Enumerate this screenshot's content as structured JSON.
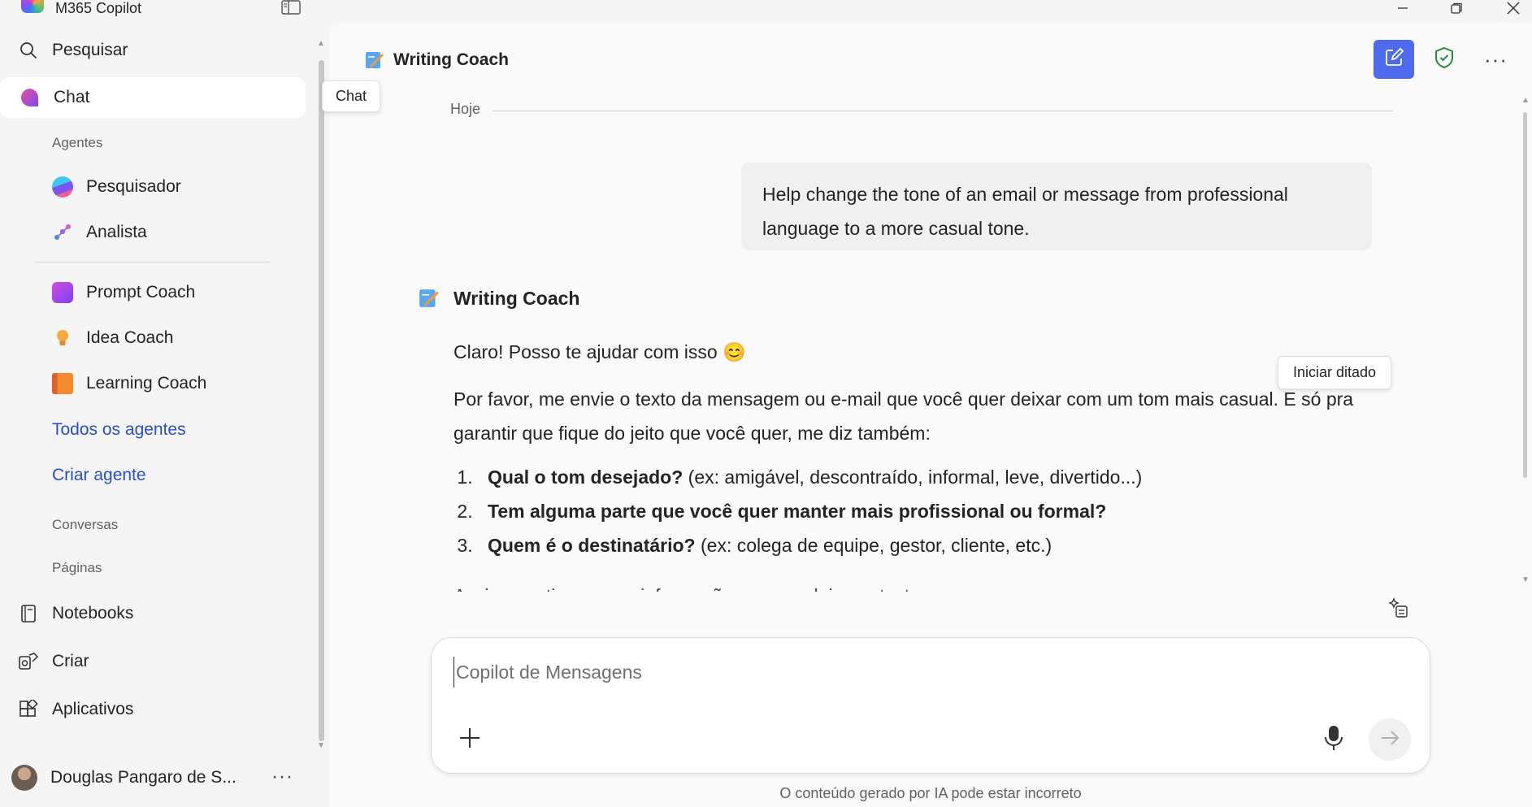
{
  "app": {
    "title": "M365 Copilot"
  },
  "sidebar": {
    "search_label": "Pesquisar",
    "chat_label": "Chat",
    "agents_section": "Agentes",
    "agents": [
      {
        "label": "Pesquisador",
        "icon": "researcher-icon"
      },
      {
        "label": "Analista",
        "icon": "analyst-icon"
      },
      {
        "label": "Prompt Coach",
        "icon": "prompt-coach-icon"
      },
      {
        "label": "Idea Coach",
        "icon": "lightbulb-icon"
      },
      {
        "label": "Learning Coach",
        "icon": "book-icon"
      }
    ],
    "all_agents_link": "Todos os agentes",
    "create_agent_link": "Criar agente",
    "conversations_section": "Conversas",
    "pages_section": "Páginas",
    "notebooks_label": "Notebooks",
    "create_label": "Criar",
    "apps_label": "Aplicativos",
    "user_name": "Douglas Pangaro de S...",
    "more_glyph": "···"
  },
  "tooltips": {
    "chat": "Chat",
    "dictate": "Iniciar ditado"
  },
  "header": {
    "title": "Writing Coach",
    "more_glyph": "···"
  },
  "conversation": {
    "date_label": "Hoje",
    "user_message": "Help change the tone of an email or message from professional language to a more casual tone.",
    "bot_name": "Writing Coach",
    "bot_greeting": "Claro! Posso te ajudar com isso 😊",
    "bot_body": "Por favor, me envie o texto da mensagem ou e-mail que você quer deixar com um tom mais casual. E só pra garantir que fique do jeito que você quer, me diz também:",
    "bot_list": [
      {
        "bold": "Qual o tom desejado?",
        "rest": " (ex: amigável, descontraído, informal, leve, divertido...)"
      },
      {
        "bold": "Tem alguma parte que você quer manter mais profissional ou formal?",
        "rest": ""
      },
      {
        "bold": "Quem é o destinatário?",
        "rest": " (ex: colega de equipe, gestor, cliente, etc.)"
      }
    ],
    "bot_cut_line": "Assim que tiver essas informações, posso deixar o texto"
  },
  "composer": {
    "placeholder": "Copilot de Mensagens"
  },
  "footer": {
    "disclaimer": "O conteúdo gerado por IA pode estar incorreto"
  },
  "colors": {
    "accent": "#4f6bed",
    "link": "#2b4fc4",
    "shield": "#1f8a3a"
  }
}
